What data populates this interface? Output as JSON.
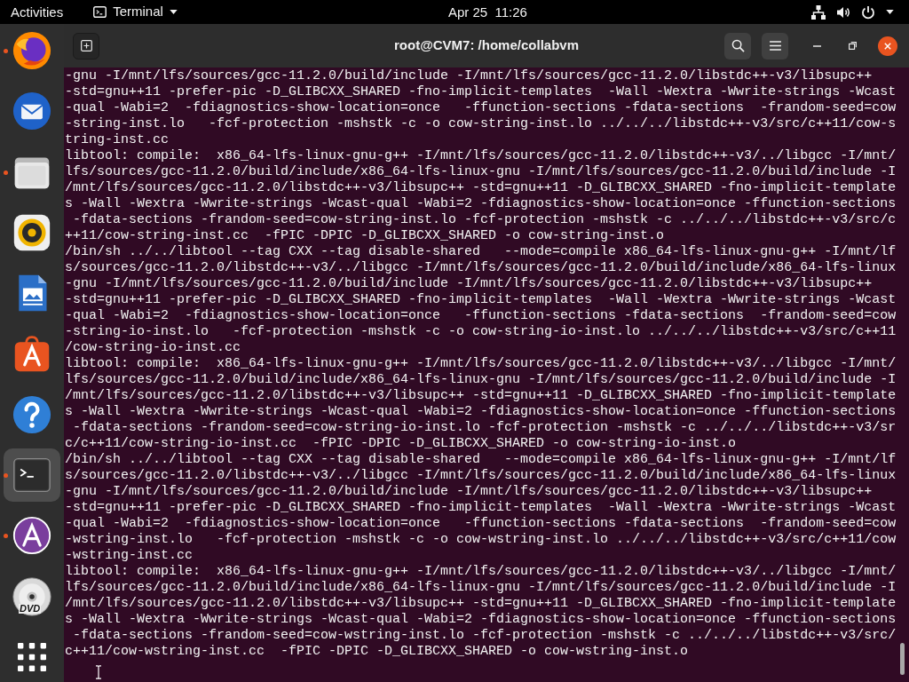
{
  "top_bar": {
    "activities": "Activities",
    "app_menu": {
      "label": "Terminal"
    },
    "clock": "Apr 25  11:26"
  },
  "dock": {
    "items": [
      {
        "kind": "browser",
        "running": true,
        "selected": false
      },
      {
        "kind": "mail",
        "running": false,
        "selected": false
      },
      {
        "kind": "files",
        "running": true,
        "selected": false
      },
      {
        "kind": "music",
        "running": false,
        "selected": false
      },
      {
        "kind": "document",
        "running": false,
        "selected": false
      },
      {
        "kind": "store",
        "running": false,
        "selected": false
      },
      {
        "kind": "help",
        "running": false,
        "selected": false
      },
      {
        "kind": "terminal",
        "running": true,
        "selected": true
      },
      {
        "kind": "installer",
        "running": true,
        "selected": false
      },
      {
        "kind": "disc",
        "running": false,
        "selected": false,
        "logo_text": "DVD"
      },
      {
        "kind": "app_grid",
        "running": false,
        "selected": false
      }
    ]
  },
  "window": {
    "title": "root@CVM7: /home/collabvm",
    "terminal": {
      "lines": [
        "-gnu -I/mnt/lfs/sources/gcc-11.2.0/build/include -I/mnt/lfs/sources/gcc-11.2.0/libstdc++-v3/libsupc++",
        "-std=gnu++11 -prefer-pic -D_GLIBCXX_SHARED -fno-implicit-templates  -Wall -Wextra -Wwrite-strings -Wcast",
        "-qual -Wabi=2  -fdiagnostics-show-location=once   -ffunction-sections -fdata-sections  -frandom-seed=cow",
        "-string-inst.lo   -fcf-protection -mshstk -c -o cow-string-inst.lo ../../../libstdc++-v3/src/c++11/cow-s",
        "tring-inst.cc",
        "libtool: compile:  x86_64-lfs-linux-gnu-g++ -I/mnt/lfs/sources/gcc-11.2.0/libstdc++-v3/../libgcc -I/mnt/",
        "lfs/sources/gcc-11.2.0/build/include/x86_64-lfs-linux-gnu -I/mnt/lfs/sources/gcc-11.2.0/build/include -I",
        "/mnt/lfs/sources/gcc-11.2.0/libstdc++-v3/libsupc++ -std=gnu++11 -D_GLIBCXX_SHARED -fno-implicit-template",
        "s -Wall -Wextra -Wwrite-strings -Wcast-qual -Wabi=2 -fdiagnostics-show-location=once -ffunction-sections",
        " -fdata-sections -frandom-seed=cow-string-inst.lo -fcf-protection -mshstk -c ../../../libstdc++-v3/src/c",
        "++11/cow-string-inst.cc  -fPIC -DPIC -D_GLIBCXX_SHARED -o cow-string-inst.o",
        "/bin/sh ../../libtool --tag CXX --tag disable-shared   --mode=compile x86_64-lfs-linux-gnu-g++ -I/mnt/lf",
        "s/sources/gcc-11.2.0/libstdc++-v3/../libgcc -I/mnt/lfs/sources/gcc-11.2.0/build/include/x86_64-lfs-linux",
        "-gnu -I/mnt/lfs/sources/gcc-11.2.0/build/include -I/mnt/lfs/sources/gcc-11.2.0/libstdc++-v3/libsupc++",
        "-std=gnu++11 -prefer-pic -D_GLIBCXX_SHARED -fno-implicit-templates  -Wall -Wextra -Wwrite-strings -Wcast",
        "-qual -Wabi=2  -fdiagnostics-show-location=once   -ffunction-sections -fdata-sections  -frandom-seed=cow",
        "-string-io-inst.lo   -fcf-protection -mshstk -c -o cow-string-io-inst.lo ../../../libstdc++-v3/src/c++11",
        "/cow-string-io-inst.cc",
        "libtool: compile:  x86_64-lfs-linux-gnu-g++ -I/mnt/lfs/sources/gcc-11.2.0/libstdc++-v3/../libgcc -I/mnt/",
        "lfs/sources/gcc-11.2.0/build/include/x86_64-lfs-linux-gnu -I/mnt/lfs/sources/gcc-11.2.0/build/include -I",
        "/mnt/lfs/sources/gcc-11.2.0/libstdc++-v3/libsupc++ -std=gnu++11 -D_GLIBCXX_SHARED -fno-implicit-template",
        "s -Wall -Wextra -Wwrite-strings -Wcast-qual -Wabi=2 -fdiagnostics-show-location=once -ffunction-sections",
        " -fdata-sections -frandom-seed=cow-string-io-inst.lo -fcf-protection -mshstk -c ../../../libstdc++-v3/sr",
        "c/c++11/cow-string-io-inst.cc  -fPIC -DPIC -D_GLIBCXX_SHARED -o cow-string-io-inst.o",
        "/bin/sh ../../libtool --tag CXX --tag disable-shared   --mode=compile x86_64-lfs-linux-gnu-g++ -I/mnt/lf",
        "s/sources/gcc-11.2.0/libstdc++-v3/../libgcc -I/mnt/lfs/sources/gcc-11.2.0/build/include/x86_64-lfs-linux",
        "-gnu -I/mnt/lfs/sources/gcc-11.2.0/build/include -I/mnt/lfs/sources/gcc-11.2.0/libstdc++-v3/libsupc++",
        "-std=gnu++11 -prefer-pic -D_GLIBCXX_SHARED -fno-implicit-templates  -Wall -Wextra -Wwrite-strings -Wcast",
        "-qual -Wabi=2  -fdiagnostics-show-location=once   -ffunction-sections -fdata-sections  -frandom-seed=cow",
        "-wstring-inst.lo   -fcf-protection -mshstk -c -o cow-wstring-inst.lo ../../../libstdc++-v3/src/c++11/cow",
        "-wstring-inst.cc",
        "libtool: compile:  x86_64-lfs-linux-gnu-g++ -I/mnt/lfs/sources/gcc-11.2.0/libstdc++-v3/../libgcc -I/mnt/",
        "lfs/sources/gcc-11.2.0/build/include/x86_64-lfs-linux-gnu -I/mnt/lfs/sources/gcc-11.2.0/build/include -I",
        "/mnt/lfs/sources/gcc-11.2.0/libstdc++-v3/libsupc++ -std=gnu++11 -D_GLIBCXX_SHARED -fno-implicit-template",
        "s -Wall -Wextra -Wwrite-strings -Wcast-qual -Wabi=2 -fdiagnostics-show-location=once -ffunction-sections",
        " -fdata-sections -frandom-seed=cow-wstring-inst.lo -fcf-protection -mshstk -c ../../../libstdc++-v3/src/",
        "c++11/cow-wstring-inst.cc  -fPIC -DPIC -D_GLIBCXX_SHARED -o cow-wstring-inst.o"
      ]
    }
  }
}
